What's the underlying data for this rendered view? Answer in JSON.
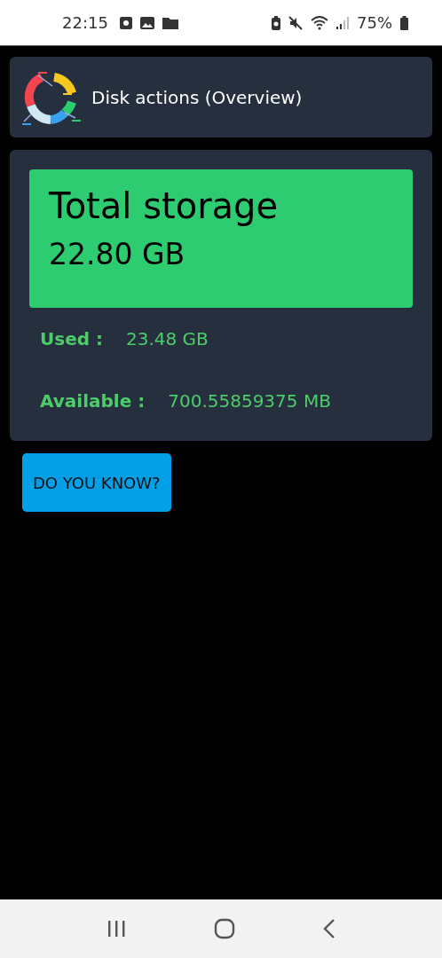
{
  "status_bar": {
    "time": "22:15",
    "battery": "75%"
  },
  "header": {
    "title": "Disk actions (Overview)"
  },
  "total": {
    "title": "Total storage",
    "value": "22.80 GB"
  },
  "stats": [
    {
      "label": "Used :",
      "value": "23.48 GB"
    },
    {
      "label": "Available :",
      "value": "700.55859375 MB"
    }
  ],
  "button": {
    "label": "DO YOU KNOW?"
  }
}
